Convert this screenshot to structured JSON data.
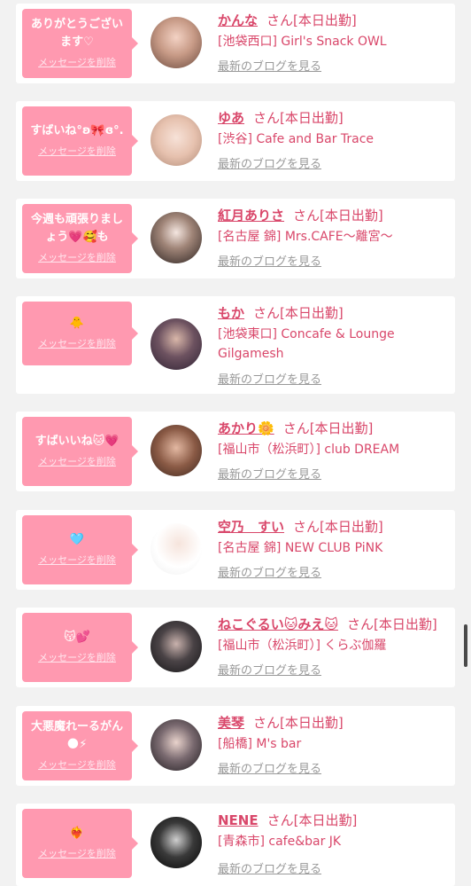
{
  "delete_label": "メッセージを削除",
  "blog_label": "最新のブログを見る",
  "san_label": "さん",
  "status_label": "[本日出勤]",
  "colors": {
    "bubble": "#ff99b0",
    "accent": "#d9476a",
    "link_gray": "#999999"
  },
  "entries": [
    {
      "message": "ありがとうございます♡",
      "name": "かんな",
      "shop": "[池袋西口] Girl's Snack OWL"
    },
    {
      "message": "すばいね°ʚ🎀ɞ°.",
      "name": "ゆあ",
      "shop": "[渋谷] Cafe and Bar Trace"
    },
    {
      "message": "今週も頑張りましょう💗🥰も",
      "name": "紅月ありさ",
      "shop": "[名古屋 錦] Mrs.CAFE～離宮～"
    },
    {
      "message": "🐥",
      "name": "もか",
      "shop": "[池袋東口] Concafe & Lounge Gilgamesh"
    },
    {
      "message": "すばいいね🐱💗",
      "name": "あかり🌼",
      "shop": "[福山市（松浜町）] club DREAM"
    },
    {
      "message": "🩵",
      "name": "空乃　すい",
      "shop": "[名古屋 錦] NEW CLUB PiNK"
    },
    {
      "message": "😽💕",
      "name": "ねこぐるい🐱みえ🐱",
      "shop": "[福山市（松浜町）] くらぶ伽羅"
    },
    {
      "message": "大悪魔れーるがん🌑⚡",
      "name": "美琴",
      "shop": "[船橋] M's bar"
    },
    {
      "message": "❤️‍🔥",
      "name": "NENE",
      "shop": "[青森市] cafe&bar JK"
    }
  ]
}
